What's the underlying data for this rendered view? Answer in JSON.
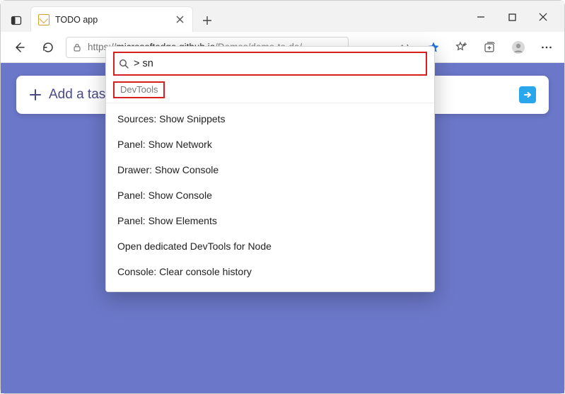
{
  "titlebar": {
    "tab_title": "TODO app"
  },
  "toolbar": {
    "url_scheme": "https://",
    "url_host": "microsoftedge.github.io",
    "url_path": "/Demos/demo-to-do/"
  },
  "page": {
    "add_task_label": "Add a task"
  },
  "command_menu": {
    "query": "> sn",
    "category": "DevTools",
    "items": [
      "Sources: Show Snippets",
      "Panel: Show Network",
      "Drawer: Show Console",
      "Panel: Show Console",
      "Panel: Show Elements",
      "Open dedicated DevTools for Node",
      "Console: Clear console history"
    ]
  }
}
